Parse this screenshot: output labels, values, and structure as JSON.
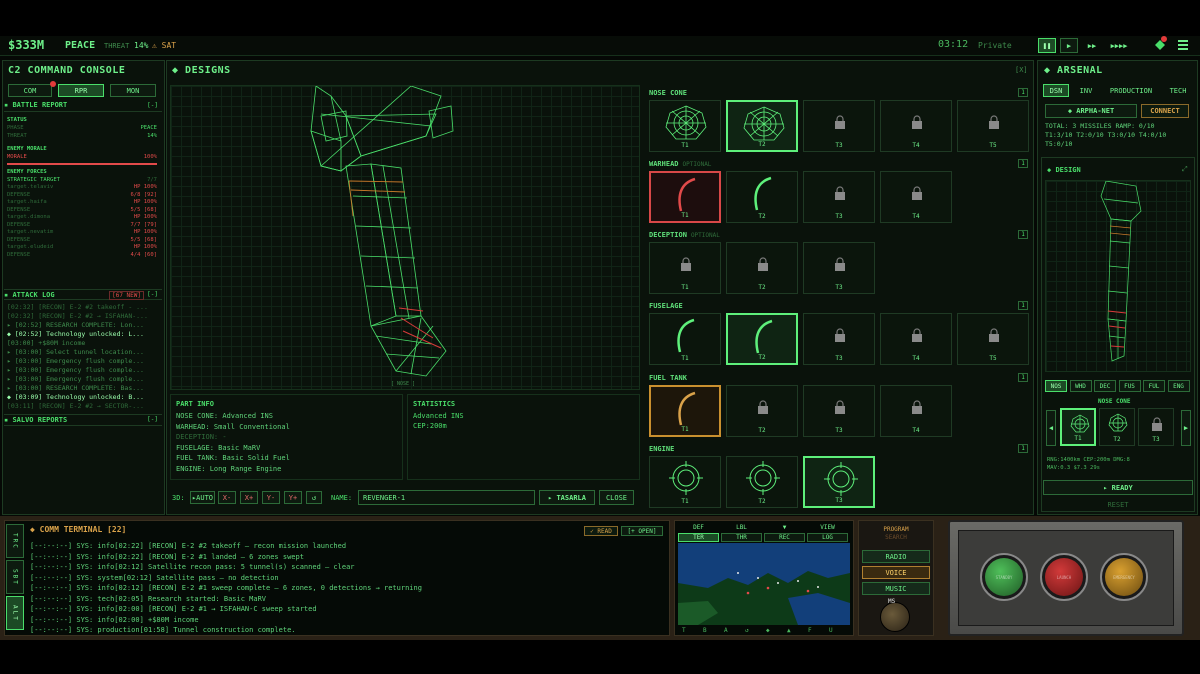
{
  "topbar": {
    "money": "$333M",
    "state": "PEACE",
    "threat_label": "THREAT",
    "threat_value": "14%",
    "sat": "⚠ SAT",
    "time": "03:12",
    "mode": "Private",
    "badge_count": "0"
  },
  "left": {
    "title": "C2 COMMAND CONSOLE",
    "tabs": [
      "COM",
      "RPR",
      "MON"
    ],
    "battle_report": "BATTLE REPORT",
    "status_hdr": "STATUS",
    "phase_k": "PHASE",
    "phase_v": "PEACE",
    "threat_k": "THREAT",
    "threat_v": "14%",
    "morale_hdr": "ENEMY MORALE",
    "morale_k": "MORALE",
    "morale_v": "100%",
    "forces_hdr": "ENEMY FORCES",
    "strategic_k": "STRATEGIC TARGET",
    "strategic_v": "7/7",
    "forces": [
      {
        "k": "target.telaviv",
        "v": "HP 100%"
      },
      {
        "k": "DEFENSE",
        "v": "6/8 [92]"
      },
      {
        "k": "target.haifa",
        "v": "HP 100%"
      },
      {
        "k": "DEFENSE",
        "v": "5/5 [68]"
      },
      {
        "k": "target.dimona",
        "v": "HP 100%"
      },
      {
        "k": "DEFENSE",
        "v": "7/7 [79]"
      },
      {
        "k": "target.nevatim",
        "v": "HP 100%"
      },
      {
        "k": "DEFENSE",
        "v": "5/5 [68]"
      },
      {
        "k": "target.eludeid",
        "v": "HP 100%"
      },
      {
        "k": "DEFENSE",
        "v": "4/4 [60]"
      }
    ],
    "attack_log": "ATTACK LOG",
    "attack_new": "[67 NEW]",
    "log": [
      "[02:32] [RECON] E-2 #2 takeoff - ...",
      "[02:32] [RECON] E-2 #2 → ISFAHAN-...",
      "▸ [02:52] RESEARCH COMPLETE: Lon...",
      "◆ [02:52] Technology unlocked: L...",
      "[03:00] +$80M income",
      "▸ [03:00] Select tunnel location...",
      "▸ [03:00] Emergency flush comple...",
      "▸ [03:00] Emergency flush comple...",
      "▸ [03:00] Emergency flush comple...",
      "▸ [03:00] RESEARCH COMPLETE: Bas...",
      "◆ [03:09] Technology unlocked: B...",
      "[03:11] [RECON] E-2 #2 → SECTOR-..."
    ],
    "salvo": "SALVO REPORTS"
  },
  "designs": {
    "title": "DESIGNS",
    "close_x": "[X]",
    "view_caption": "[ NOSE ]",
    "part_info_title": "PART INFO",
    "part_info": [
      "NOSE CONE: Advanced INS",
      "WARHEAD: Small Conventional",
      "DECEPTION: -",
      "FUSELAGE: Basic MaRV",
      "FUEL TANK: Basic Solid Fuel",
      "ENGINE: Long Range Engine"
    ],
    "stats_title": "STATISTICS",
    "stats": [
      "Advanced INS",
      "CEP:200m"
    ],
    "rot_label": "3D:",
    "rot_buttons": [
      "▸AUTO",
      "X-",
      "X+",
      "Y-",
      "Y+",
      "↺"
    ],
    "name_label": "NAME:",
    "name_value": "REVENGER-1",
    "save_btn": "▸ TASARLA",
    "close_btn": "CLOSE",
    "rows": [
      {
        "title": "NOSE CONE",
        "opt": "",
        "count": "1",
        "tiles": [
          "T1",
          "T2",
          "T3",
          "T4",
          "T5"
        ]
      },
      {
        "title": "WARHEAD",
        "opt": "OPTIONAL",
        "count": "1",
        "tiles": [
          "T1",
          "T2",
          "T3",
          "T4"
        ]
      },
      {
        "title": "DECEPTION",
        "opt": "OPTIONAL",
        "count": "1",
        "tiles": [
          "T1",
          "T2",
          "T3"
        ]
      },
      {
        "title": "FUSELAGE",
        "opt": "",
        "count": "1",
        "tiles": [
          "T1",
          "T2",
          "T3",
          "T4",
          "T5"
        ]
      },
      {
        "title": "FUEL TANK",
        "opt": "",
        "count": "1",
        "tiles": [
          "T1",
          "T2",
          "T3",
          "T4"
        ]
      },
      {
        "title": "ENGINE",
        "opt": "",
        "count": "1",
        "tiles": [
          "T1",
          "T2",
          "T3"
        ]
      }
    ]
  },
  "arsenal": {
    "title": "ARSENAL",
    "tabs": [
      "DSN",
      "INV",
      "PRODUCTION",
      "TECH"
    ],
    "net_btn": "◆ ARPHA-NET",
    "connect_btn": "CONNECT",
    "summary": [
      "TOTAL: 3 MISSILES RAMP: 0/10",
      "T1:3/10 T2:0/10 T3:0/10 T4:0/10",
      "T5:0/10"
    ],
    "design_title": "DESIGN",
    "part_tabs": [
      "NOS",
      "WHD",
      "DEC",
      "FUS",
      "FUL",
      "ENG"
    ],
    "nose_label": "NOSE CONE",
    "nose_tiles": [
      "T1",
      "T2",
      "T3"
    ],
    "specs": [
      "RNG:1400km CEP:200m DMG:8",
      "MAV:0.3 $7.3 29s"
    ],
    "ready_btn": "▸ READY",
    "reset_btn": "RESET"
  },
  "terminal": {
    "title": "COMM TERMINAL [22]",
    "read_btn": "✓ READ",
    "open_btn": "[+ OPEN]",
    "side_tabs": [
      "TRC",
      "SBT",
      "ALT"
    ],
    "lines": [
      "[--:--:--] SYS: info[02:22] [RECON] E-2 #2 takeoff — recon mission launched",
      "[--:--:--] SYS: info[02:22] [RECON] E-2 #1 landed — 6 zones swept",
      "[--:--:--] SYS: info[02:12] Satellite recon pass: 5 tunnel(s) scanned — clear",
      "[--:--:--] SYS: system[02:12] Satellite pass — no detection",
      "[--:--:--] SYS: info[02:12] [RECON] E-2 #1 sweep complete — 6 zones, 0 detections → returning",
      "[--:--:--] SYS: tech[02:05] Research started: Basic MaRV",
      "[--:--:--] SYS: info[02:00] [RECON] E-2 #1 → ISFAHAN-C sweep started",
      "[--:--:--] SYS: info[02:00] +$80M income",
      "[--:--:--] SYS: production[01:58] Tunnel construction complete."
    ]
  },
  "map": {
    "tabs_top": [
      "DEF",
      "LBL",
      "▼",
      "VIEW"
    ],
    "tabs_bot": [
      "TER",
      "THR",
      "REC",
      "LOG"
    ],
    "axis": [
      "T",
      "B",
      "A",
      "↺",
      "◆",
      "▲",
      "F",
      "U"
    ]
  },
  "radio": {
    "program": "PROGRAM",
    "program_sub": "SEARCH",
    "items": [
      "RADIO",
      "VOICE",
      "MUSIC"
    ],
    "knob": "MS"
  },
  "console": {
    "buttons": [
      "STANDBY",
      "LAUNCH",
      "EMERGENCY"
    ]
  }
}
